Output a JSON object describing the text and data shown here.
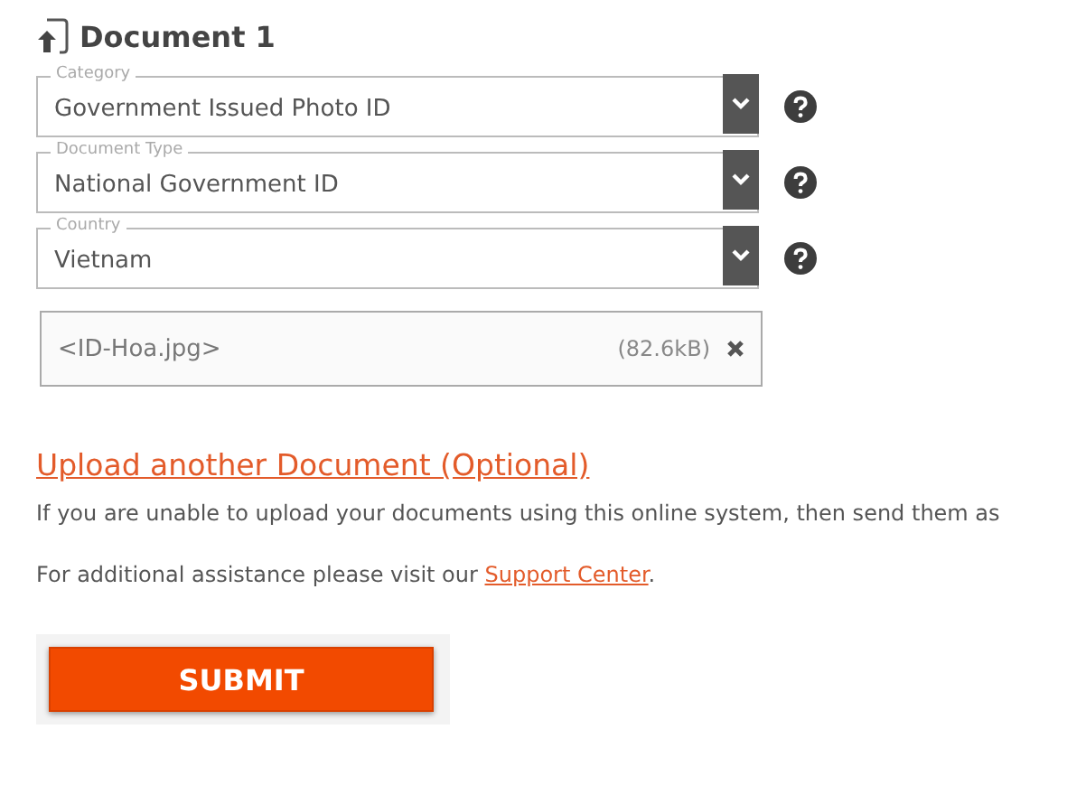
{
  "heading": "Document 1",
  "selects": [
    {
      "label": "Category",
      "value": "Government Issued Photo ID"
    },
    {
      "label": "Document Type",
      "value": "National Government ID"
    },
    {
      "label": "Country",
      "value": "Vietnam"
    }
  ],
  "file": {
    "name": "<ID-Hoa.jpg>",
    "size": "(82.6kB)"
  },
  "upload_link": "Upload another Document (Optional)",
  "note": "If you are unable to upload your documents using this online system, then send them as",
  "assistance": {
    "before": "For additional assistance please visit our ",
    "link": "Support Center",
    "after": "."
  },
  "submit": "SUBMIT"
}
